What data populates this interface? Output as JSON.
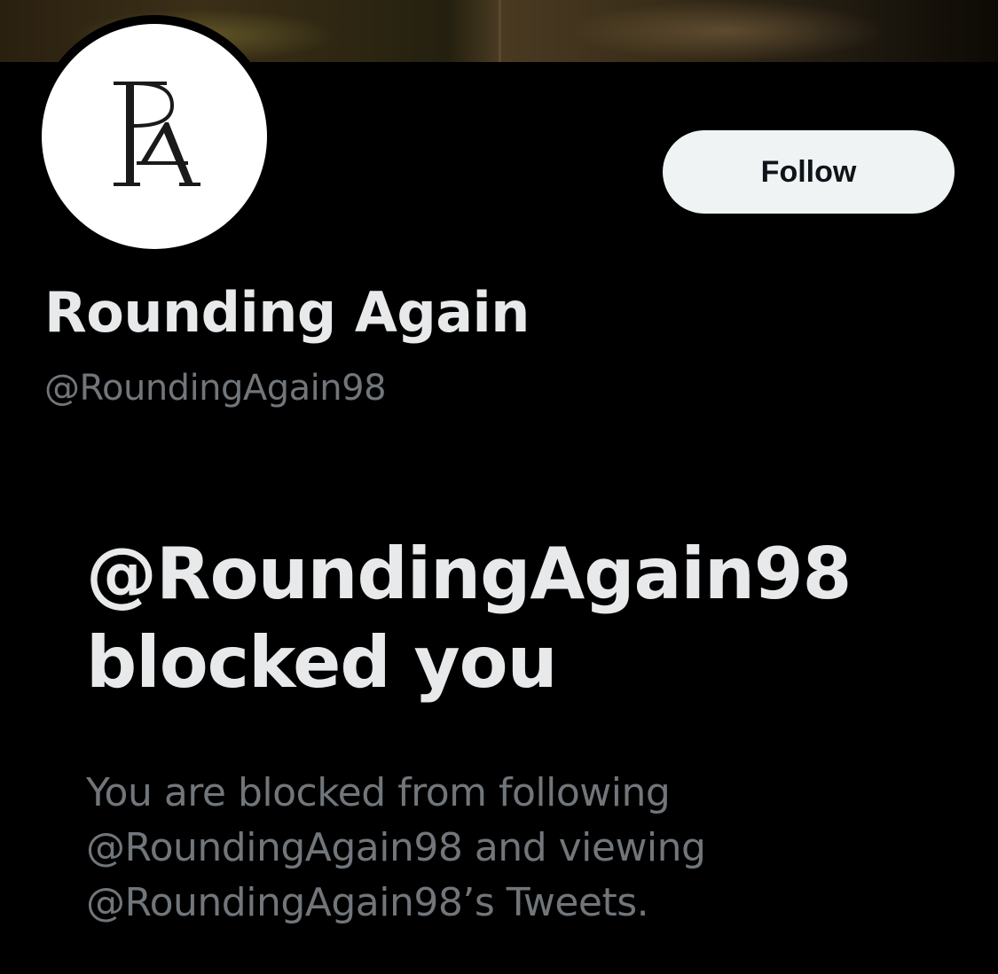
{
  "profile": {
    "display_name": "Rounding Again",
    "handle": "@RoundingAgain98",
    "avatar_monogram": "RA",
    "follow_label": "Follow"
  },
  "blocked_notice": {
    "title": "@RoundingAgain98 blocked you",
    "description": "You are blocked from following @RoundingAgain98 and viewing @RoundingAgain98’s Tweets."
  },
  "colors": {
    "background": "#000000",
    "primary_text": "#e7e9ea",
    "secondary_text": "#71767b",
    "follow_button_bg": "#eff3f4",
    "follow_button_text": "#0f1419"
  },
  "icons": {
    "avatar": "ra-monogram-logo"
  }
}
